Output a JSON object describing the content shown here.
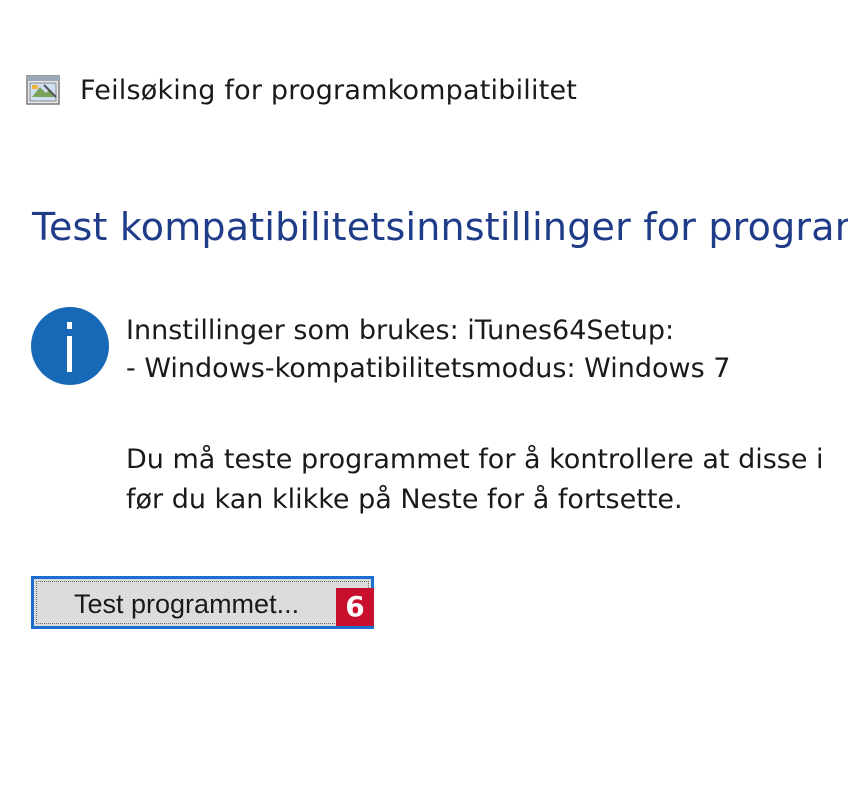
{
  "window": {
    "title": "Feilsøking for programkompatibilitet",
    "icon": "compatibility-troubleshooter-icon"
  },
  "main": {
    "heading": "Test kompatibilitetsinnstillinger for program",
    "info_icon": "info-icon",
    "settings_lines": [
      "Innstillinger som brukes: iTunes64Setup:",
      "- Windows-kompatibilitetsmodus: Windows 7"
    ],
    "description_lines": [
      "Du må teste programmet for å kontrollere at disse i",
      "før du kan klikke på Neste for å fortsette."
    ],
    "test_button_label": "Test programmet...",
    "step_badge": "6"
  },
  "colors": {
    "heading": "#1f3c88",
    "info_circle": "#1868b8",
    "button_border": "#1b6fd0",
    "button_bg": "#dcdcdc",
    "badge": "#c8102e"
  }
}
